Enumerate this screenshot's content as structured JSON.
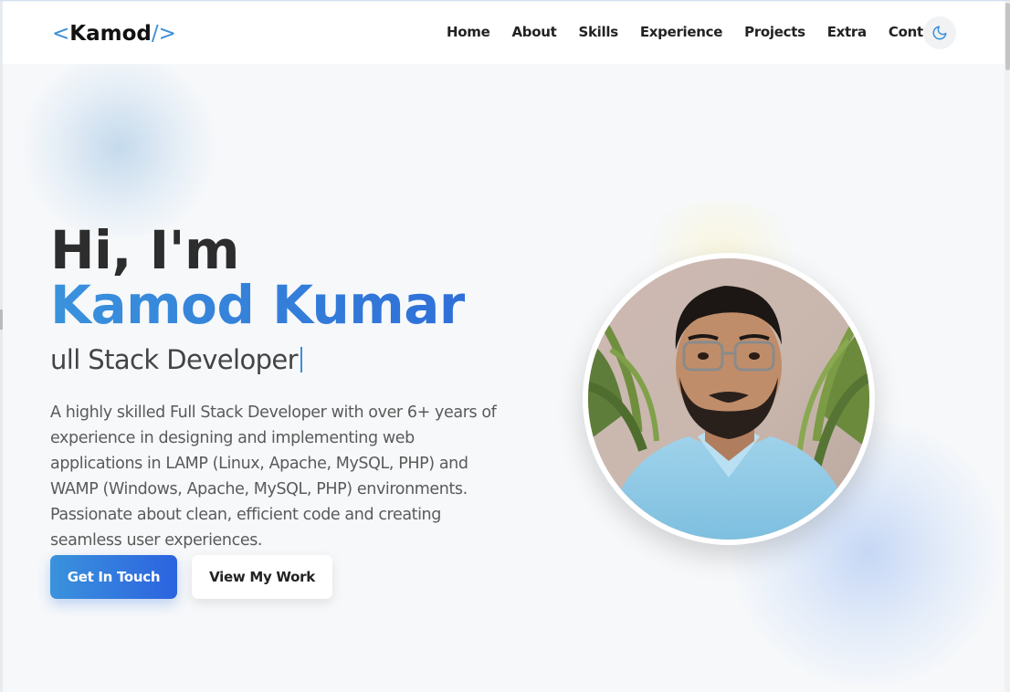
{
  "logo": {
    "open": "<",
    "name": "Kamod",
    "close": "/>"
  },
  "nav": {
    "items": [
      "Home",
      "About",
      "Skills",
      "Experience",
      "Projects",
      "Extra",
      "Contact"
    ]
  },
  "theme_toggle": {
    "icon": "moon-icon"
  },
  "hero": {
    "greeting": "Hi, I'm",
    "name": "Kamod Kumar",
    "role": "ull Stack Developer",
    "description": "A highly skilled Full Stack Developer with over 6+ years of experience in designing and implementing web applications in LAMP (Linux, Apache, MySQL, PHP) and WAMP (Windows, Apache, MySQL, PHP) environments. Passionate about clean, efficient code and creating seamless user experiences.",
    "primary_button": "Get In Touch",
    "secondary_button": "View My Work"
  },
  "colors": {
    "accent": "#3b8fd9",
    "accent_dark": "#2c63e0",
    "text": "#2d2d2d",
    "background": "#f6f8fa"
  }
}
